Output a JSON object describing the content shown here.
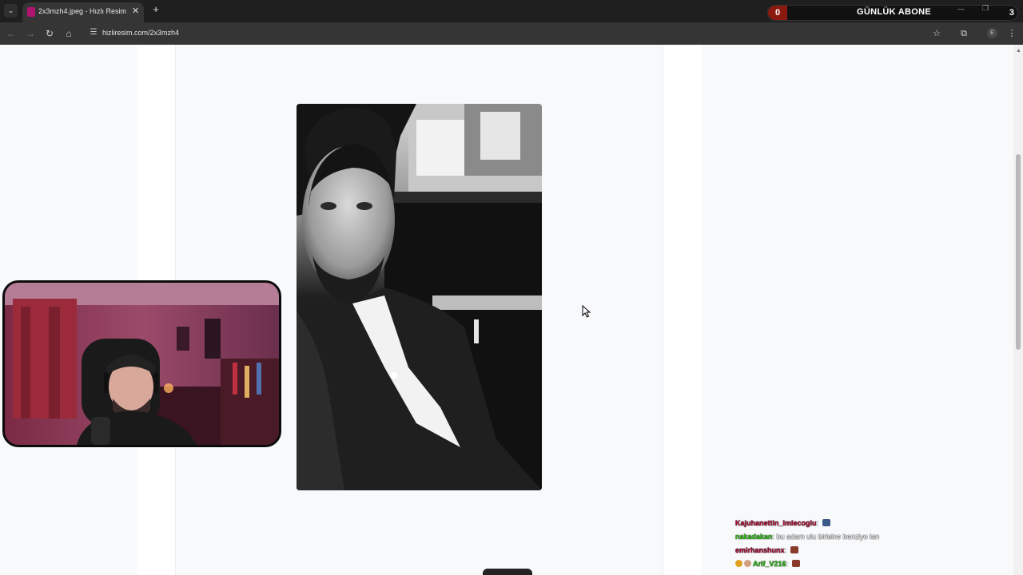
{
  "browser": {
    "tab_title": "2x3mzh4.jpeg - Hızlı Resim",
    "tab_close": "✕",
    "new_tab": "+",
    "address": "hizliresim.com/2x3mzh4",
    "profile_initial": "E"
  },
  "subscriber_widget": {
    "left_count": "0",
    "label": "GÜNLÜK ABONE",
    "right_count": "3"
  },
  "icons": {
    "tab_list": "chevron-down-icon",
    "back": "arrow-left-icon",
    "forward": "arrow-right-icon",
    "reload": "reload-icon",
    "home": "home-icon",
    "site_info": "tune-icon",
    "bookmark": "star-icon",
    "extensions": "puzzle-icon",
    "menu": "kebab-menu-icon"
  },
  "colors": {
    "brand_favicon": "#b0146e",
    "abone_badge": "#8a1a10",
    "user_red": "#b0103a",
    "user_green": "#34c11a"
  },
  "chat": {
    "messages": [
      {
        "user": "Kajuhanettin_Imlecoglu",
        "message": "",
        "user_color": "#b0103a",
        "emote": "bus-emote"
      },
      {
        "user": "nakadakan",
        "message": "bu adam ulu birisine benziyo lan",
        "user_color": "#34c11a",
        "emote": ""
      },
      {
        "user": "emirhanshunx",
        "message": "",
        "user_color": "#b0103a",
        "emote": "face-emote"
      },
      {
        "user": "Arif_V216",
        "message": "",
        "user_color": "#34c11a",
        "emote": "face-emote"
      }
    ]
  }
}
